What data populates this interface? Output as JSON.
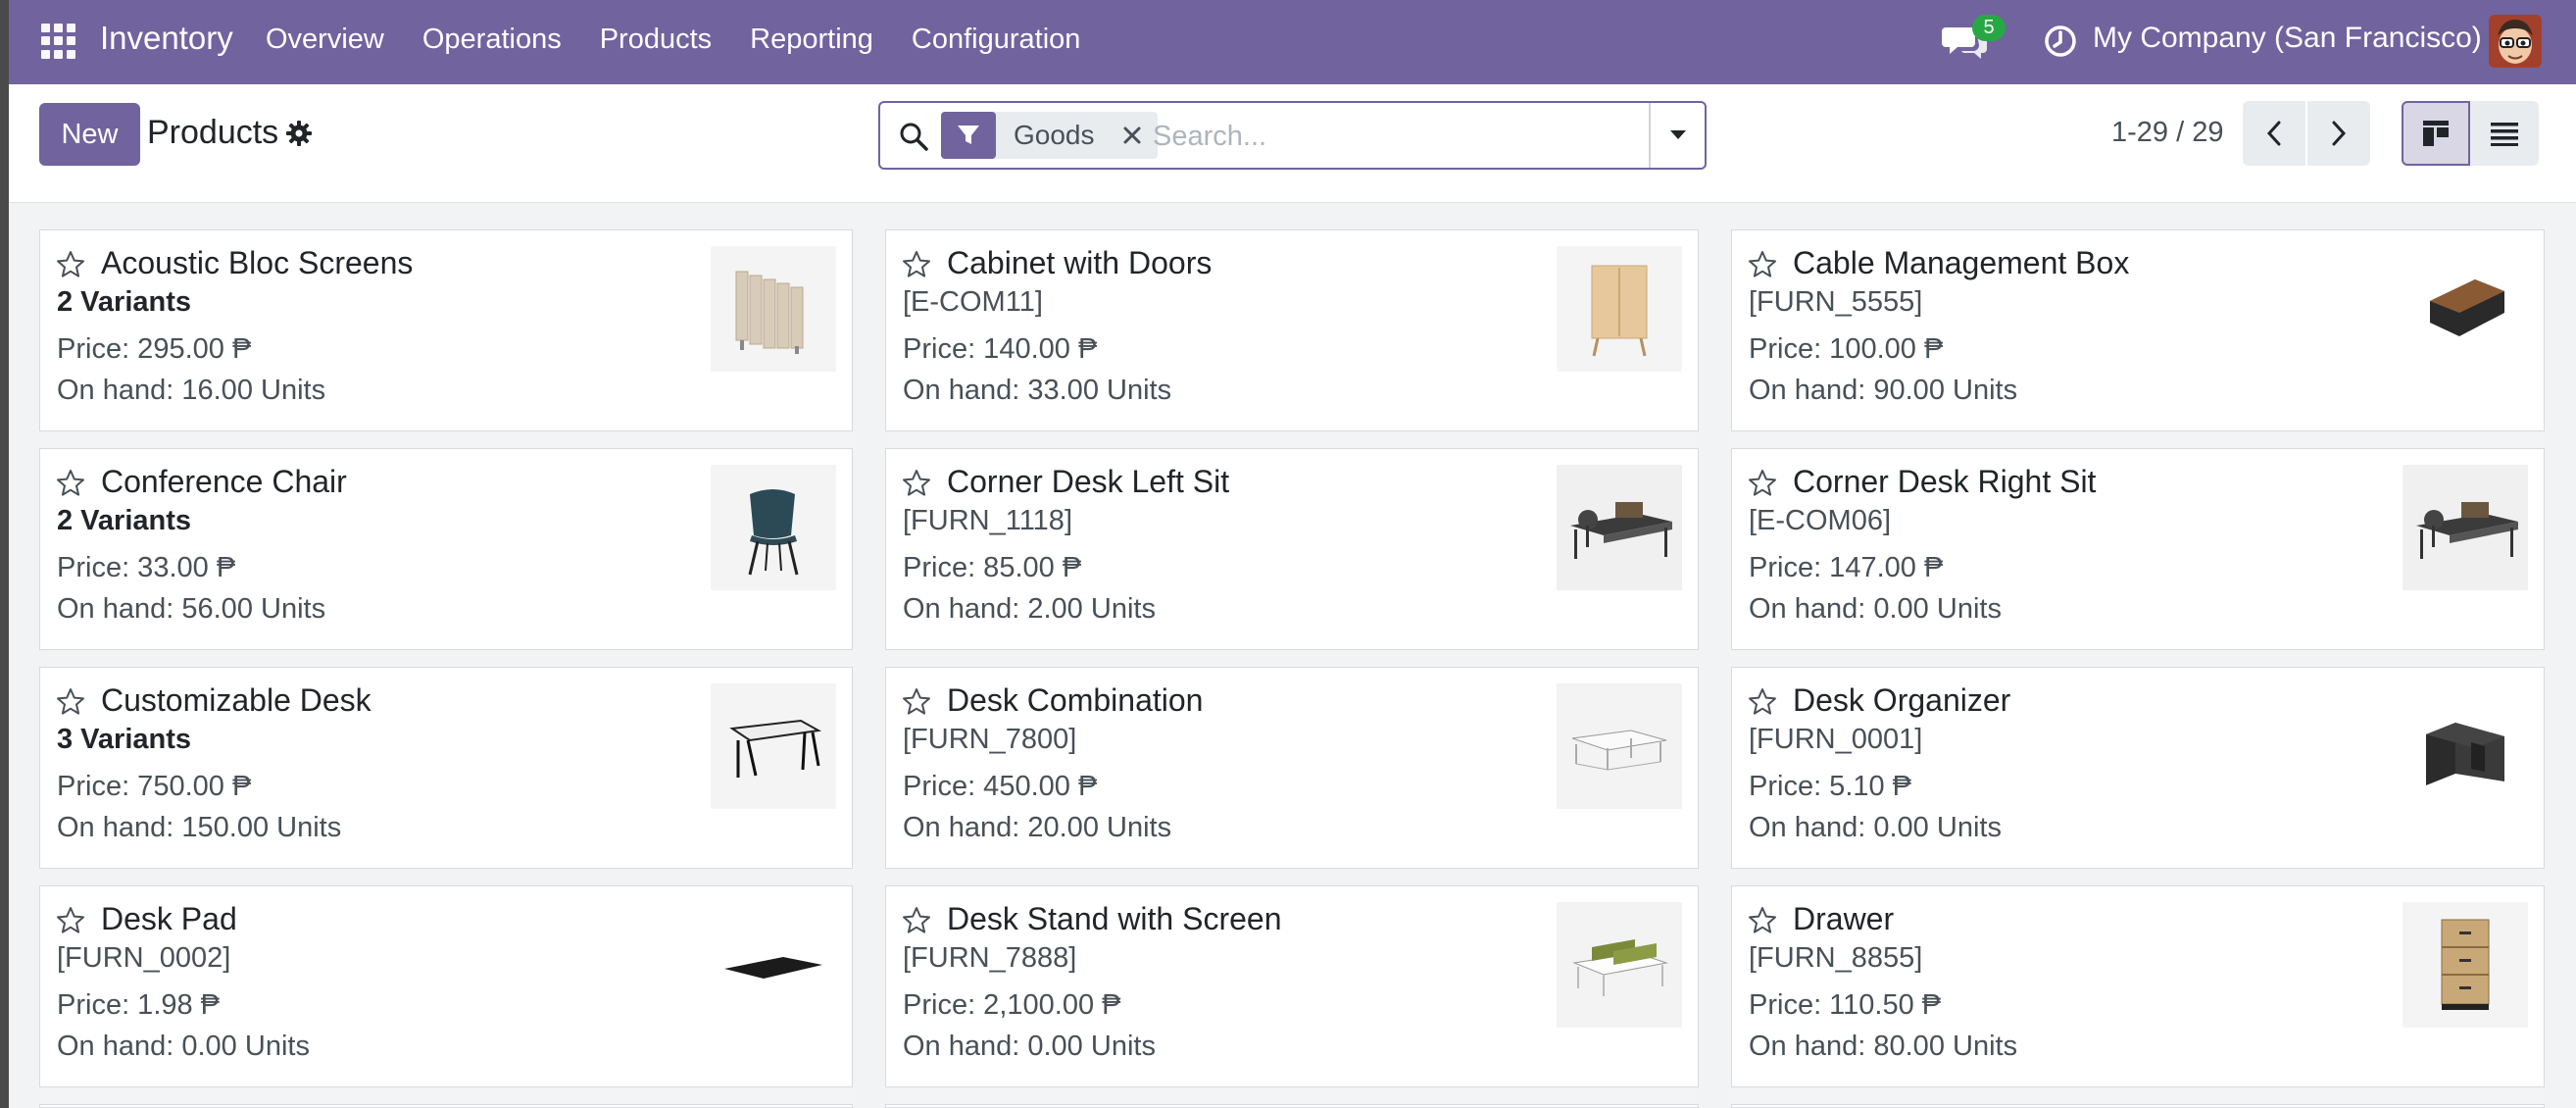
{
  "navbar": {
    "app_name": "Inventory",
    "menu": [
      "Overview",
      "Operations",
      "Products",
      "Reporting",
      "Configuration"
    ],
    "chat_count": "5",
    "company": "My Company (San Francisco)"
  },
  "control": {
    "new_label": "New",
    "title": "Products",
    "facet_value": "Goods",
    "search_placeholder": "Search...",
    "pager": "1-29 / 29"
  },
  "colors": {
    "brand": "#71639e",
    "badge": "#28a745"
  },
  "products": [
    {
      "name": "Acoustic Bloc Screens",
      "ref": "2 Variants",
      "ref_bold": true,
      "price": "Price: 295.00 ₱",
      "onhand": "On hand: 16.00 Units",
      "icon": "acoustic-screen-image"
    },
    {
      "name": "Cabinet with Doors",
      "ref": "[E-COM11]",
      "ref_bold": false,
      "price": "Price: 140.00 ₱",
      "onhand": "On hand: 33.00 Units",
      "icon": "cabinet-image"
    },
    {
      "name": "Cable Management Box",
      "ref": "[FURN_5555]",
      "ref_bold": false,
      "price": "Price: 100.00 ₱",
      "onhand": "On hand: 90.00 Units",
      "icon": "cable-box-image"
    },
    {
      "name": "Conference Chair",
      "ref": "2 Variants",
      "ref_bold": true,
      "price": "Price: 33.00 ₱",
      "onhand": "On hand: 56.00 Units",
      "icon": "chair-image"
    },
    {
      "name": "Corner Desk Left Sit",
      "ref": "[FURN_1118]",
      "ref_bold": false,
      "price": "Price: 85.00 ₱",
      "onhand": "On hand: 2.00 Units",
      "icon": "corner-desk-image"
    },
    {
      "name": "Corner Desk Right Sit",
      "ref": "[E-COM06]",
      "ref_bold": false,
      "price": "Price: 147.00 ₱",
      "onhand": "On hand: 0.00 Units",
      "icon": "corner-desk-image"
    },
    {
      "name": "Customizable Desk",
      "ref": "3 Variants",
      "ref_bold": true,
      "price": "Price: 750.00 ₱",
      "onhand": "On hand: 150.00 Units",
      "icon": "desk-image"
    },
    {
      "name": "Desk Combination",
      "ref": "[FURN_7800]",
      "ref_bold": false,
      "price": "Price: 450.00 ₱",
      "onhand": "On hand: 20.00 Units",
      "icon": "desk-combination-image"
    },
    {
      "name": "Desk Organizer",
      "ref": "[FURN_0001]",
      "ref_bold": false,
      "price": "Price: 5.10 ₱",
      "onhand": "On hand: 0.00 Units",
      "icon": "organizer-image"
    },
    {
      "name": "Desk Pad",
      "ref": "[FURN_0002]",
      "ref_bold": false,
      "price": "Price: 1.98 ₱",
      "onhand": "On hand: 0.00 Units",
      "icon": "desk-pad-image"
    },
    {
      "name": "Desk Stand with Screen",
      "ref": "[FURN_7888]",
      "ref_bold": false,
      "price": "Price: 2,100.00 ₱",
      "onhand": "On hand: 0.00 Units",
      "icon": "desk-stand-image"
    },
    {
      "name": "Drawer",
      "ref": "[FURN_8855]",
      "ref_bold": false,
      "price": "Price: 110.50 ₱",
      "onhand": "On hand: 80.00 Units",
      "icon": "drawer-image"
    }
  ]
}
